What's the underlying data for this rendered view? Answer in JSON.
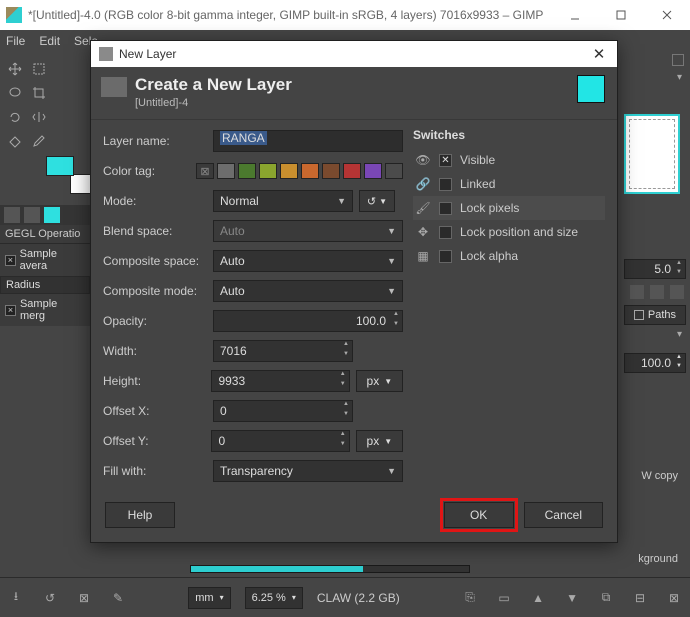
{
  "window": {
    "title": "*[Untitled]-4.0 (RGB color 8-bit gamma integer, GIMP built-in sRGB, 4 layers) 7016x9933 – GIMP"
  },
  "menubar": [
    "File",
    "Edit",
    "Sele"
  ],
  "left_panel": {
    "op_label": "GEGL Operatio",
    "sample_avg": "Sample avera",
    "radius_label": "Radius",
    "sample_merge": "Sample merg"
  },
  "right_panel": {
    "zoom_value": "5.0",
    "paths_tab": "Paths",
    "opacity_value": "100.0"
  },
  "bg_text": {
    "wcopy": "W copy",
    "kground": "kground"
  },
  "bottom": {
    "unit": "mm",
    "zoom": "6.25 %",
    "mem": "CLAW (2.2 GB)"
  },
  "dialog": {
    "title": "New Layer",
    "heading": "Create a New Layer",
    "subheading": "[Untitled]-4",
    "labels": {
      "layer_name": "Layer name:",
      "color_tag": "Color tag:",
      "mode": "Mode:",
      "blend_space": "Blend space:",
      "composite_space": "Composite space:",
      "composite_mode": "Composite mode:",
      "opacity": "Opacity:",
      "width": "Width:",
      "height": "Height:",
      "offset_x": "Offset X:",
      "offset_y": "Offset Y:",
      "fill": "Fill with:"
    },
    "values": {
      "layer_name": "RANGA",
      "mode": "Normal",
      "blend_space": "Auto",
      "composite_space": "Auto",
      "composite_mode": "Auto",
      "opacity": "100.0",
      "width": "7016",
      "height": "9933",
      "offset_x": "0",
      "offset_y": "0",
      "fill": "Transparency",
      "unit1": "px",
      "unit2": "px",
      "reset": "↺"
    },
    "color_tags": [
      "#3a3a3a",
      "#6d6d6d",
      "#4b7a2e",
      "#8aa52e",
      "#c98f2e",
      "#c9682e",
      "#7a4a2e",
      "#b53434",
      "#7a47b5",
      "#4b4b4b"
    ],
    "switches": {
      "heading": "Switches",
      "items": [
        {
          "icon": "eye",
          "label": "Visible",
          "checked": true
        },
        {
          "icon": "link",
          "label": "Linked",
          "checked": false
        },
        {
          "icon": "brush",
          "label": "Lock pixels",
          "checked": false,
          "hl": true
        },
        {
          "icon": "move",
          "label": "Lock position and size",
          "checked": false
        },
        {
          "icon": "alpha",
          "label": "Lock alpha",
          "checked": false
        }
      ]
    },
    "buttons": {
      "help": "Help",
      "ok": "OK",
      "cancel": "Cancel"
    }
  }
}
